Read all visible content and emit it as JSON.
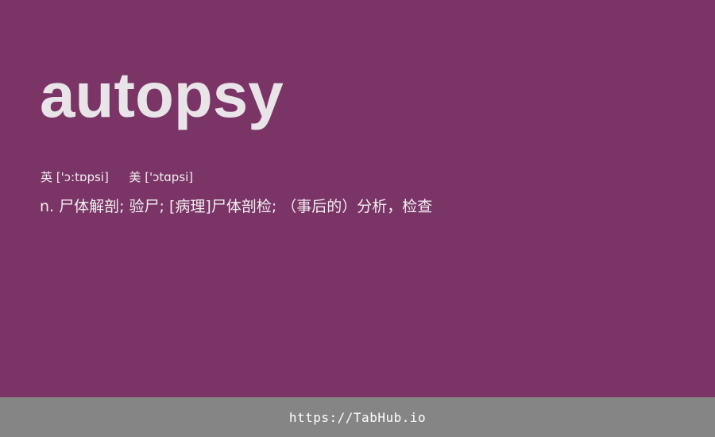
{
  "entry": {
    "word": "autopsy",
    "phonetic_uk_label": "英",
    "phonetic_uk": "['ɔ:tɒpsi]",
    "phonetic_us_label": "美",
    "phonetic_us": "['ɔtɑpsi]",
    "definition": "n. 尸体解剖; 验尸; [病理]尸体剖检; （事后的）分析，检查"
  },
  "footer": {
    "link_text": "https://TabHub.io"
  },
  "colors": {
    "background": "#7a3566",
    "footer_background": "#858585",
    "text": "#e8e4e8"
  }
}
